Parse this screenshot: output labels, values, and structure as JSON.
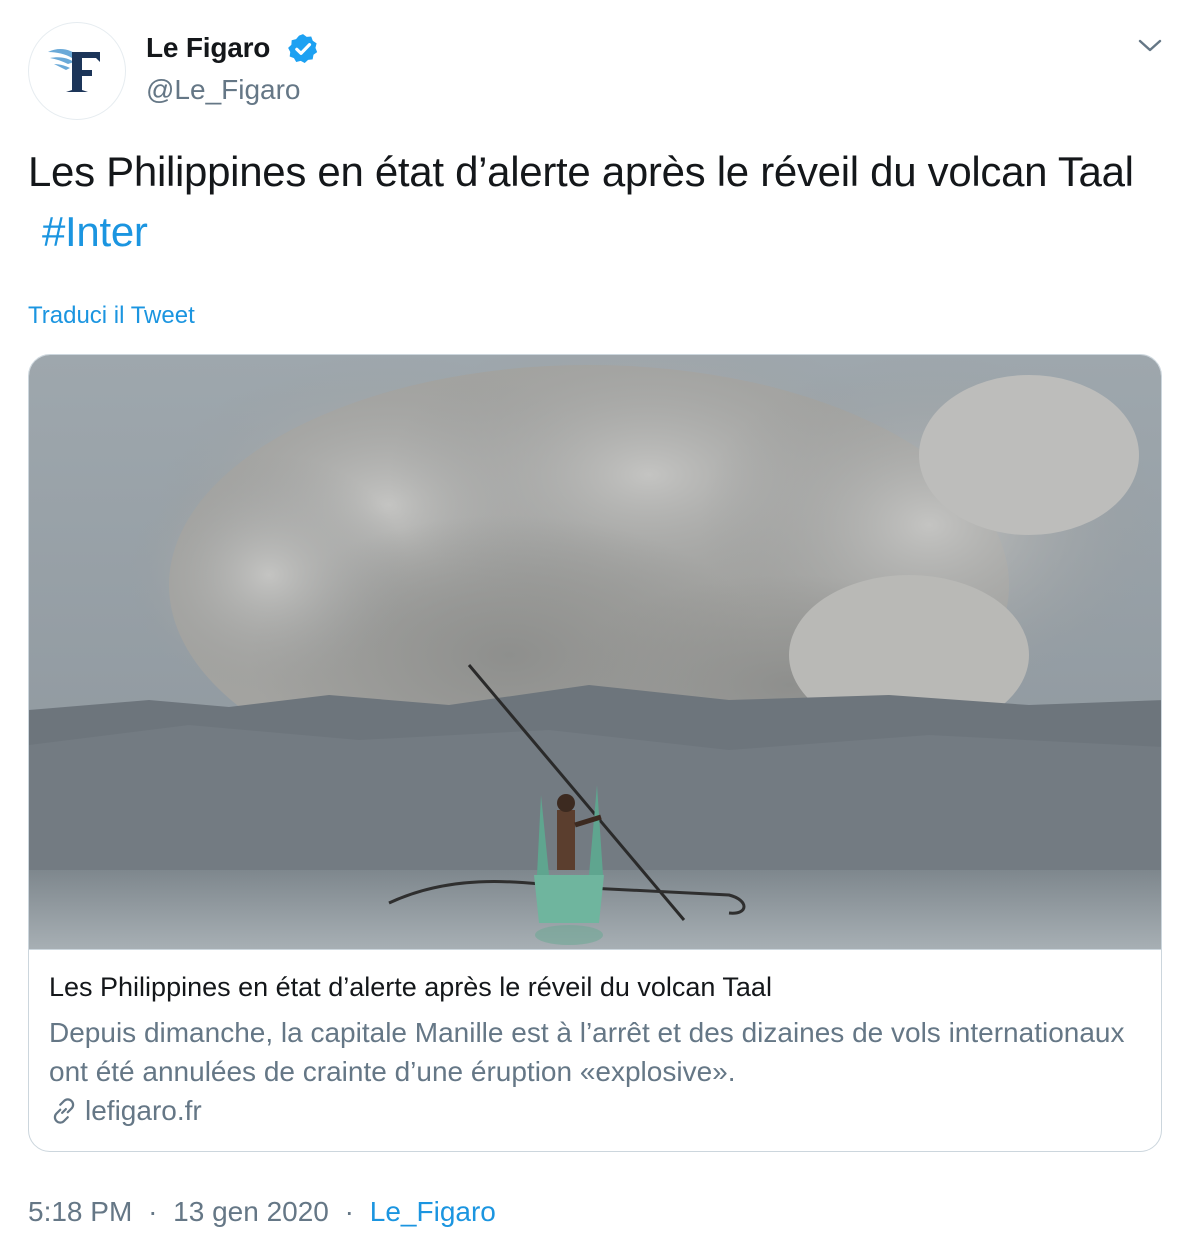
{
  "author": {
    "display_name": "Le Figaro",
    "handle": "@Le_Figaro",
    "verified": true,
    "avatar_letter": "F"
  },
  "tweet": {
    "text": "Les Philippines en état d’alerte après le réveil du volcan Taal",
    "hashtag": "#Inter",
    "translate_label": "Traduci il Tweet"
  },
  "card": {
    "title": "Les Philippines en état d’alerte après le réveil du volcan Taal",
    "description": "Depuis dimanche, la capitale Manille est à l’arrêt et des dizaines de vols internationaux ont été annulées de crainte d’une éruption «explosive».",
    "domain": "lefigaro.fr",
    "link_icon": "link-icon"
  },
  "meta": {
    "time": "5:18 PM",
    "separator": "·",
    "date": "13 gen 2020",
    "source": "Le_Figaro"
  },
  "colors": {
    "link_blue": "#1b95e0",
    "secondary_text": "#657786",
    "border": "#ccd6dd",
    "brand_navy": "#1c3559",
    "brand_light_blue": "#6aa9d8"
  }
}
